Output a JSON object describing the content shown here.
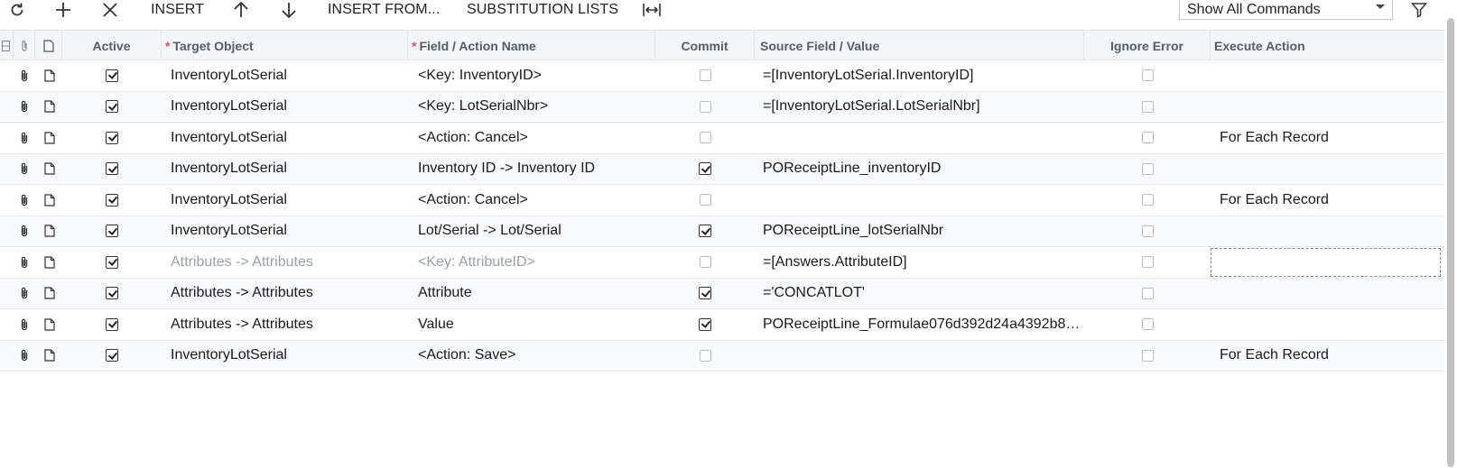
{
  "toolbar": {
    "refresh_icon": "refresh-icon",
    "add_icon": "plus-icon",
    "delete_icon": "close-icon",
    "insert_label": "INSERT",
    "move_up_icon": "arrow-up-icon",
    "move_down_icon": "arrow-down-icon",
    "insert_from_label": "INSERT FROM...",
    "substitution_lists_label": "SUBSTITUTION LISTS",
    "fit_columns_icon": "fit-columns-icon",
    "commands_filter": "Show All Commands",
    "filter_icon": "filter-icon"
  },
  "columns": {
    "active": "Active",
    "target_object": "Target Object",
    "field_action_name": "Field / Action Name",
    "commit": "Commit",
    "source_field_value": "Source Field / Value",
    "ignore_error": "Ignore Error",
    "execute_action": "Execute Action",
    "required_mark": "*"
  },
  "rows": [
    {
      "target": "InventoryLotSerial",
      "field": "<Key: InventoryID>",
      "commit": false,
      "source": "=[InventoryLotSerial.InventoryID]",
      "ignore": false,
      "execute": ""
    },
    {
      "target": "InventoryLotSerial",
      "field": "<Key: LotSerialNbr>",
      "commit": false,
      "source": "=[InventoryLotSerial.LotSerialNbr]",
      "ignore": false,
      "execute": ""
    },
    {
      "target": "InventoryLotSerial",
      "field": "<Action: Cancel>",
      "commit": false,
      "source": "",
      "ignore": false,
      "execute": "For Each Record"
    },
    {
      "target": "InventoryLotSerial",
      "field": "Inventory ID -> Inventory ID",
      "commit": true,
      "source": "POReceiptLine_inventoryID",
      "ignore": false,
      "execute": ""
    },
    {
      "target": "InventoryLotSerial",
      "field": "<Action: Cancel>",
      "commit": false,
      "source": "",
      "ignore": false,
      "execute": "For Each Record"
    },
    {
      "target": "InventoryLotSerial",
      "field": "Lot/Serial -> Lot/Serial",
      "commit": true,
      "source": "POReceiptLine_lotSerialNbr",
      "ignore": false,
      "execute": ""
    },
    {
      "target": "Attributes -> Attributes",
      "field": "<Key: AttributeID>",
      "commit": false,
      "source": "=[Answers.AttributeID]",
      "ignore": false,
      "execute": "",
      "muted": true,
      "selected": true
    },
    {
      "target": "Attributes -> Attributes",
      "field": "Attribute",
      "commit": true,
      "source": "='CONCATLOT'",
      "ignore": false,
      "execute": ""
    },
    {
      "target": "Attributes -> Attributes",
      "field": "Value",
      "commit": true,
      "source": "POReceiptLine_Formulae076d392d24a4392b8…",
      "ignore": false,
      "execute": ""
    },
    {
      "target": "InventoryLotSerial",
      "field": "<Action: Save>",
      "commit": false,
      "source": "",
      "ignore": false,
      "execute": "For Each Record"
    }
  ]
}
